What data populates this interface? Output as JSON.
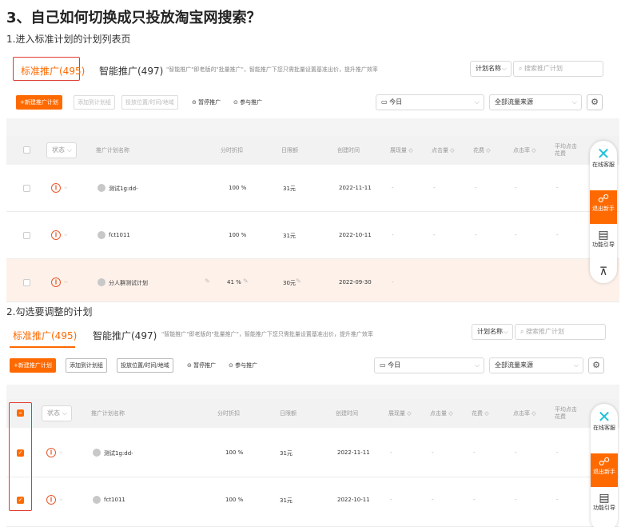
{
  "heading": "3、自己如何切换成只投放淘宝网搜索？",
  "step1": "1.进入标准计划的计划列表页",
  "step2": "2.勾选要调整的计划",
  "tabs": {
    "standard": "标准推广(495)",
    "smart": "智能推广(497)",
    "note": "\"智能推广\"即老版的\"批量推广\"，智能推广下您只需批量设置基准出价，提升推广效率"
  },
  "header_controls": {
    "plan_name_select": "计划名称",
    "search_placeholder": "搜索推广计划"
  },
  "toolbar": {
    "new_plan": "+新建推广计划",
    "add_to_group": "添加到计划组",
    "placement": "投放位置/时间/地域",
    "pause": "暂停推广",
    "join": "参与推广",
    "date_select": "今日",
    "traffic_select": "全部流量来源"
  },
  "columns": {
    "status": "状态",
    "plan_name": "推广计划名称",
    "discount": "分时折扣",
    "limit": "日限额",
    "created": "创建时间",
    "impressions": "展现量",
    "clicks": "点击量",
    "cost": "花费",
    "ctr": "点击率",
    "avg_cpc": "平均点击花费"
  },
  "rows": [
    {
      "name": "测试1g:dd-",
      "discount": "100 %",
      "limit": "31元",
      "created": "2022-11-11",
      "dash": "-"
    },
    {
      "name": "fct1011",
      "discount": "100 %",
      "limit": "31元",
      "created": "2022-10-11",
      "dash": "-"
    },
    {
      "name": "分人群测试计划",
      "discount": "41 %",
      "limit": "30元",
      "created": "2022-09-30",
      "dash": "-"
    }
  ],
  "float_panel": {
    "service": "在线客服",
    "exit_newbie": "退出新手",
    "guide": "功能引导"
  },
  "colors": {
    "accent": "#ff6a00",
    "highlight_border": "#e03a2f"
  },
  "icons": [
    "search-icon",
    "gear-icon",
    "calendar-icon",
    "chevron-down-icon",
    "pause-icon",
    "pencil-icon",
    "service-logo-icon",
    "exit-icon",
    "guide-icon",
    "back-to-top-icon"
  ]
}
